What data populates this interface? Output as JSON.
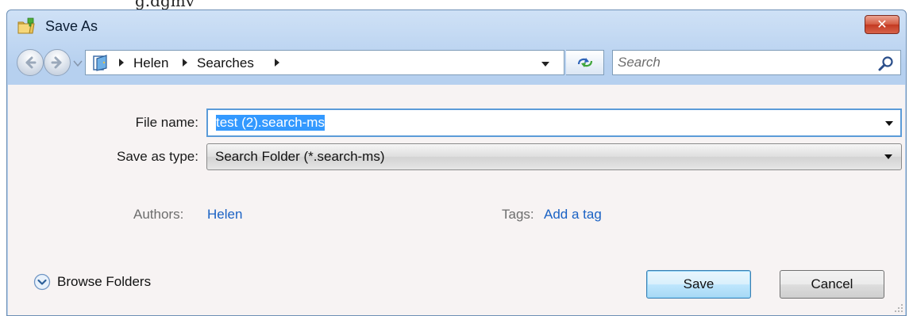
{
  "top_strip_text": "g.dgmv",
  "dialog": {
    "title": "Save As",
    "close_label": "✕"
  },
  "navigation": {
    "breadcrumbs": [
      "Helen",
      "Searches"
    ],
    "search_placeholder": "Search"
  },
  "form": {
    "file_name_label": "File name:",
    "file_name_value": "test (2).search-ms",
    "save_type_label": "Save as type:",
    "save_type_value": "Search Folder (*.search-ms)",
    "authors_label": "Authors:",
    "authors_value": "Helen",
    "tags_label": "Tags:",
    "tags_value": "Add a tag"
  },
  "footer": {
    "browse_label": "Browse Folders",
    "save_label": "Save",
    "cancel_label": "Cancel"
  },
  "icons": {
    "window": "save-folder-icon",
    "back": "back-arrow-icon",
    "forward": "forward-arrow-icon",
    "refresh": "refresh-icon",
    "search": "magnifier-icon",
    "browse": "expand-circle-icon"
  },
  "colors": {
    "title_bar": "#b6d0ef",
    "close_button": "#c43a22",
    "focus_border": "#5b9bd8",
    "selection": "#3399ff",
    "link": "#1a62c4",
    "content_bg": "#f7f3f3"
  }
}
